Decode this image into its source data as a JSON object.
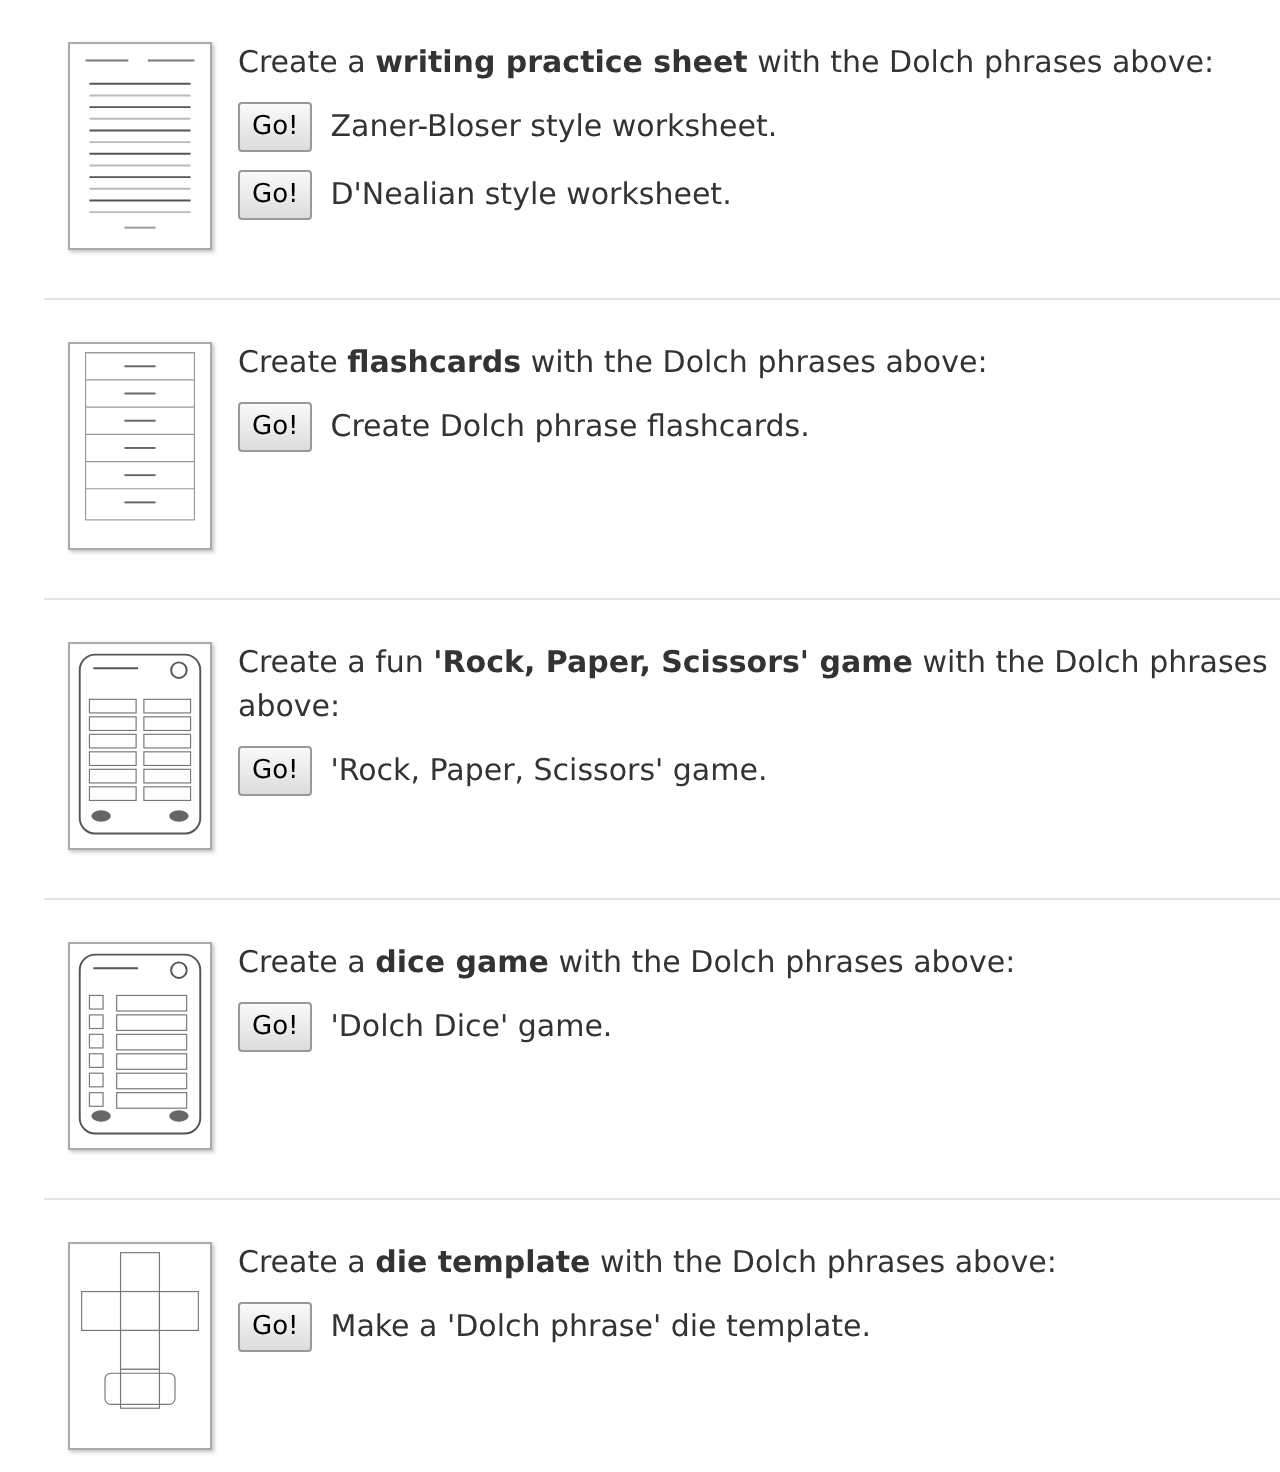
{
  "sections": [
    {
      "thumbnail": {
        "kind": "lines"
      },
      "lead": "Create a **writing practice sheet** with the Dolch phrases above:",
      "options": [
        {
          "button": "Go!",
          "label": "Zaner-Bloser style worksheet."
        },
        {
          "button": "Go!",
          "label": "D'Nealian style worksheet."
        }
      ]
    },
    {
      "thumbnail": {
        "kind": "cards"
      },
      "lead": "Create **flashcards** with the Dolch phrases above:",
      "options": [
        {
          "button": "Go!",
          "label": "Create Dolch phrase flashcards."
        }
      ]
    },
    {
      "thumbnail": {
        "kind": "game"
      },
      "lead": "Create a fun **'Rock, Paper, Scissors' game** with the Dolch phrases above:",
      "options": [
        {
          "button": "Go!",
          "label": "'Rock, Paper, Scissors' game."
        }
      ]
    },
    {
      "thumbnail": {
        "kind": "dice"
      },
      "lead": "Create a **dice game** with the Dolch phrases above:",
      "options": [
        {
          "button": "Go!",
          "label": "'Dolch Dice' game."
        }
      ]
    },
    {
      "thumbnail": {
        "kind": "die"
      },
      "lead": "Create a **die template** with the Dolch phrases above:",
      "options": [
        {
          "button": "Go!",
          "label": "Make a 'Dolch phrase' die template."
        }
      ]
    }
  ]
}
